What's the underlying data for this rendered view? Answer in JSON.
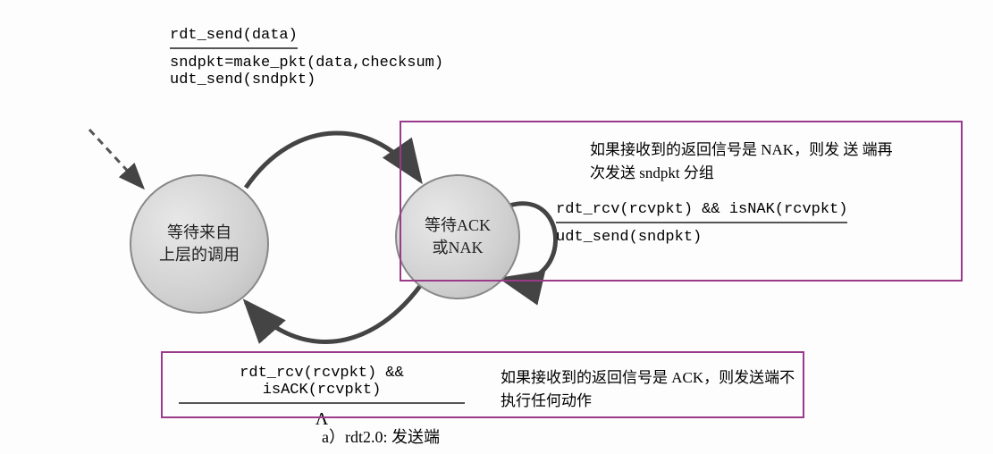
{
  "states": {
    "wait_call": "等待来自\n上层的调用",
    "wait_ack": "等待ACK\n或NAK"
  },
  "transitions": {
    "send": {
      "event": "rdt_send(data)",
      "action1": "sndpkt=make_pkt(data,checksum)",
      "action2": "udt_send(sndpkt)"
    },
    "nak_loop": {
      "event": "rdt_rcv(rcvpkt) && isNAK(rcvpkt)",
      "action": "udt_send(sndpkt)"
    },
    "ack_return": {
      "event": "rdt_rcv(rcvpkt) && isACK(rcvpkt)",
      "action": "Λ"
    }
  },
  "annotations": {
    "nak": "如果接收到的返回信号是 NAK，则发 送 端再次发送 sndpkt 分组",
    "ack": "如果接收到的返回信号是 ACK，则发送端不执行任何动作"
  },
  "caption": "a）rdt2.0: 发送端"
}
